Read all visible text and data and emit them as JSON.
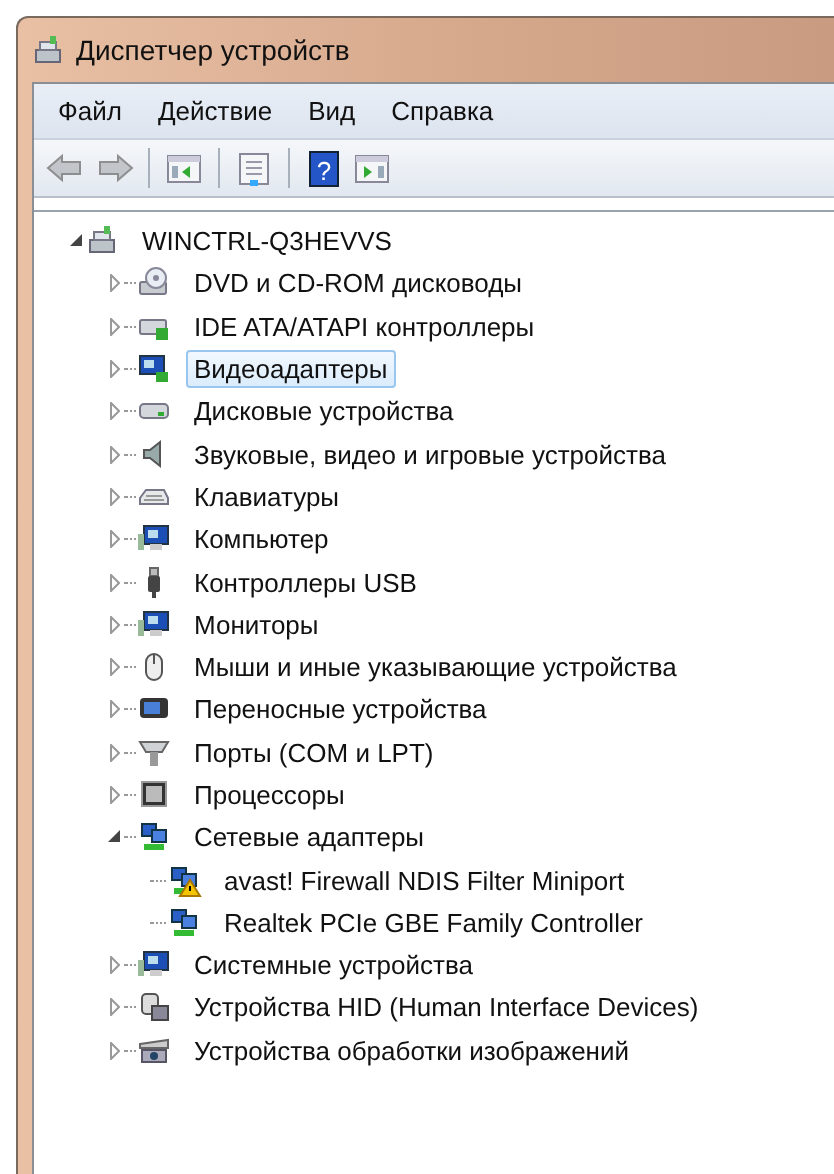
{
  "window": {
    "title": "Диспетчер устройств"
  },
  "menu": [
    "Файл",
    "Действие",
    "Вид",
    "Справка"
  ],
  "toolbar": [
    {
      "kind": "back",
      "disabled": true
    },
    {
      "kind": "forward",
      "disabled": true
    },
    {
      "kind": "sep"
    },
    {
      "kind": "tree",
      "disabled": false
    },
    {
      "kind": "sep"
    },
    {
      "kind": "properties",
      "disabled": false
    },
    {
      "kind": "sep"
    },
    {
      "kind": "help",
      "disabled": false,
      "glyph": "?"
    },
    {
      "kind": "pane",
      "disabled": false
    }
  ],
  "tree": {
    "label": "WINCTRL-Q3HEVVS",
    "kind": "computer",
    "expanded": true,
    "selected": false,
    "children": [
      {
        "label": "DVD и CD-ROM дисководы",
        "kind": "disc",
        "expanded": false,
        "selected": false
      },
      {
        "label": "IDE ATA/ATAPI контроллеры",
        "kind": "controller",
        "expanded": false,
        "selected": false
      },
      {
        "label": "Видеоадаптеры",
        "kind": "display",
        "expanded": false,
        "selected": true
      },
      {
        "label": "Дисковые устройства",
        "kind": "drive",
        "expanded": false,
        "selected": false
      },
      {
        "label": "Звуковые, видео и игровые устройства",
        "kind": "speaker",
        "expanded": false,
        "selected": false
      },
      {
        "label": "Клавиатуры",
        "kind": "keyboard",
        "expanded": false,
        "selected": false
      },
      {
        "label": "Компьютер",
        "kind": "monitor",
        "expanded": false,
        "selected": false
      },
      {
        "label": "Контроллеры USB",
        "kind": "usb",
        "expanded": false,
        "selected": false
      },
      {
        "label": "Мониторы",
        "kind": "monitor",
        "expanded": false,
        "selected": false
      },
      {
        "label": "Мыши и иные указывающие устройства",
        "kind": "mouse",
        "expanded": false,
        "selected": false
      },
      {
        "label": "Переносные устройства",
        "kind": "portable",
        "expanded": false,
        "selected": false
      },
      {
        "label": "Порты (COM и LPT)",
        "kind": "port",
        "expanded": false,
        "selected": false
      },
      {
        "label": "Процессоры",
        "kind": "chip",
        "expanded": false,
        "selected": false
      },
      {
        "label": "Сетевые адаптеры",
        "kind": "network",
        "expanded": true,
        "selected": false,
        "children": [
          {
            "label": "avast! Firewall NDIS Filter Miniport",
            "kind": "network",
            "selected": false,
            "warning": true
          },
          {
            "label": "Realtek PCIe GBE Family Controller",
            "kind": "network",
            "selected": false,
            "warning": false
          }
        ]
      },
      {
        "label": "Системные устройства",
        "kind": "monitor",
        "expanded": false,
        "selected": false
      },
      {
        "label": "Устройства HID (Human Interface Devices)",
        "kind": "hid",
        "expanded": false,
        "selected": false
      },
      {
        "label": "Устройства обработки изображений",
        "kind": "camera",
        "expanded": false,
        "selected": false
      }
    ]
  }
}
